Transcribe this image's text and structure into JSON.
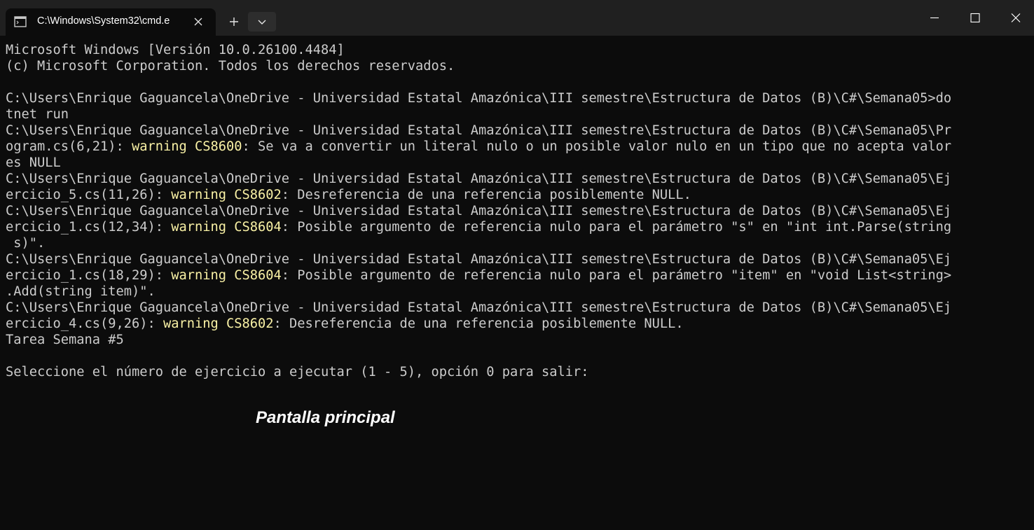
{
  "tab": {
    "title": "C:\\Windows\\System32\\cmd.e"
  },
  "console": {
    "lines": [
      [
        {
          "t": "Microsoft Windows [Versión 10.0.26100.4484]"
        }
      ],
      [
        {
          "t": "(c) Microsoft Corporation. Todos los derechos reservados."
        }
      ],
      [
        {
          "t": ""
        }
      ],
      [
        {
          "t": "C:\\Users\\Enrique Gaguancela\\OneDrive - Universidad Estatal Amazónica\\III semestre\\Estructura de Datos (B)\\C#\\Semana05>do"
        }
      ],
      [
        {
          "t": "tnet run"
        }
      ],
      [
        {
          "t": "C:\\Users\\Enrique Gaguancela\\OneDrive - Universidad Estatal Amazónica\\III semestre\\Estructura de Datos (B)\\C#\\Semana05\\Pr"
        }
      ],
      [
        {
          "t": "ogram.cs(6,21): "
        },
        {
          "t": "warning CS8600",
          "w": true
        },
        {
          "t": ": Se va a convertir un literal nulo o un posible valor nulo en un tipo que no acepta valor"
        }
      ],
      [
        {
          "t": "es NULL"
        }
      ],
      [
        {
          "t": "C:\\Users\\Enrique Gaguancela\\OneDrive - Universidad Estatal Amazónica\\III semestre\\Estructura de Datos (B)\\C#\\Semana05\\Ej"
        }
      ],
      [
        {
          "t": "ercicio_5.cs(11,26): "
        },
        {
          "t": "warning CS8602",
          "w": true
        },
        {
          "t": ": Desreferencia de una referencia posiblemente NULL."
        }
      ],
      [
        {
          "t": "C:\\Users\\Enrique Gaguancela\\OneDrive - Universidad Estatal Amazónica\\III semestre\\Estructura de Datos (B)\\C#\\Semana05\\Ej"
        }
      ],
      [
        {
          "t": "ercicio_1.cs(12,34): "
        },
        {
          "t": "warning CS8604",
          "w": true
        },
        {
          "t": ": Posible argumento de referencia nulo para el parámetro \"s\" en \"int int.Parse(string"
        }
      ],
      [
        {
          "t": " s)\"."
        }
      ],
      [
        {
          "t": "C:\\Users\\Enrique Gaguancela\\OneDrive - Universidad Estatal Amazónica\\III semestre\\Estructura de Datos (B)\\C#\\Semana05\\Ej"
        }
      ],
      [
        {
          "t": "ercicio_1.cs(18,29): "
        },
        {
          "t": "warning CS8604",
          "w": true
        },
        {
          "t": ": Posible argumento de referencia nulo para el parámetro \"item\" en \"void List<string>"
        }
      ],
      [
        {
          "t": ".Add(string item)\"."
        }
      ],
      [
        {
          "t": "C:\\Users\\Enrique Gaguancela\\OneDrive - Universidad Estatal Amazónica\\III semestre\\Estructura de Datos (B)\\C#\\Semana05\\Ej"
        }
      ],
      [
        {
          "t": "ercicio_4.cs(9,26): "
        },
        {
          "t": "warning CS8602",
          "w": true
        },
        {
          "t": ": Desreferencia de una referencia posiblemente NULL."
        }
      ],
      [
        {
          "t": "Tarea Semana #5"
        }
      ],
      [
        {
          "t": ""
        }
      ],
      [
        {
          "t": "Seleccione el número de ejercicio a ejecutar (1 - 5), opción 0 para salir:"
        }
      ]
    ]
  },
  "caption": "Pantalla principal",
  "icons": {
    "tab": "terminal-icon",
    "tab_close": "close-icon",
    "new_tab": "plus-icon",
    "dropdown": "chevron-down-icon",
    "minimize": "minimize-icon",
    "maximize": "maximize-icon",
    "close": "close-icon"
  },
  "colors": {
    "background": "#0c0c0c",
    "titlebar": "#202020",
    "text": "#cccccc",
    "warning": "#f9f1a5"
  }
}
